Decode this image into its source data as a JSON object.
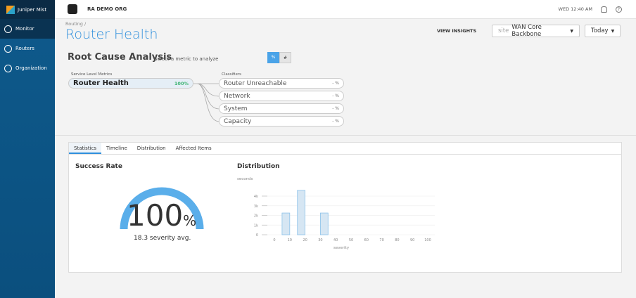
{
  "sidebar": {
    "brand": "Juniper Mist",
    "items": [
      {
        "label": "Monitor",
        "icon": "monitor-icon",
        "active": true
      },
      {
        "label": "Routers",
        "icon": "router-icon"
      },
      {
        "label": "Organization",
        "icon": "globe-icon"
      }
    ]
  },
  "topbar": {
    "org": "RA DEMO ORG",
    "time": "WED 12:40 AM",
    "help": "?"
  },
  "page": {
    "breadcrumb": "Routing /",
    "title": "Router Health",
    "view_insights": "VIEW INSIGHTS",
    "site_prefix": "site",
    "site": "WAN Core Backbone",
    "range": "Today"
  },
  "rca": {
    "title": "Root Cause Analysis",
    "subtitle": "Select a metric to analyze",
    "toggle_pct": "%",
    "toggle_count": "#",
    "slm_label": "Service Level Metrics",
    "slm": {
      "name": "Router Health",
      "value": "100%"
    },
    "classifiers_label": "Classifiers",
    "classifiers": [
      {
        "name": "Router Unreachable",
        "value": "- %"
      },
      {
        "name": "Network",
        "value": "- %"
      },
      {
        "name": "System",
        "value": "- %"
      },
      {
        "name": "Capacity",
        "value": "- %"
      }
    ]
  },
  "tabs": [
    "Statistics",
    "Timeline",
    "Distribution",
    "Affected Items"
  ],
  "stats": {
    "title": "Success Rate",
    "value": "100",
    "unit": "%",
    "severity": "18.3 severity avg.",
    "gauge_fraction": 1.0,
    "accent": "#5aaeea"
  },
  "dist": {
    "title": "Distribution"
  },
  "chart_data": {
    "type": "bar",
    "ylabel": "seconds",
    "xlabel": "severity",
    "xlim": [
      0,
      100
    ],
    "ylim": [
      0,
      4000
    ],
    "xticks": [
      "0",
      "10",
      "20",
      "30",
      "40",
      "50",
      "60",
      "70",
      "80",
      "90",
      "100"
    ],
    "yticks": [
      "0",
      "1k",
      "2k",
      "3k",
      "4k"
    ],
    "bins": [
      {
        "from": 5,
        "to": 10,
        "value": 2250
      },
      {
        "from": 15,
        "to": 20,
        "value": 4600
      },
      {
        "from": 30,
        "to": 35,
        "value": 2250
      }
    ],
    "grid": true,
    "bar_color": "#d6e6f3",
    "bar_edge": "#8ec3ea"
  }
}
